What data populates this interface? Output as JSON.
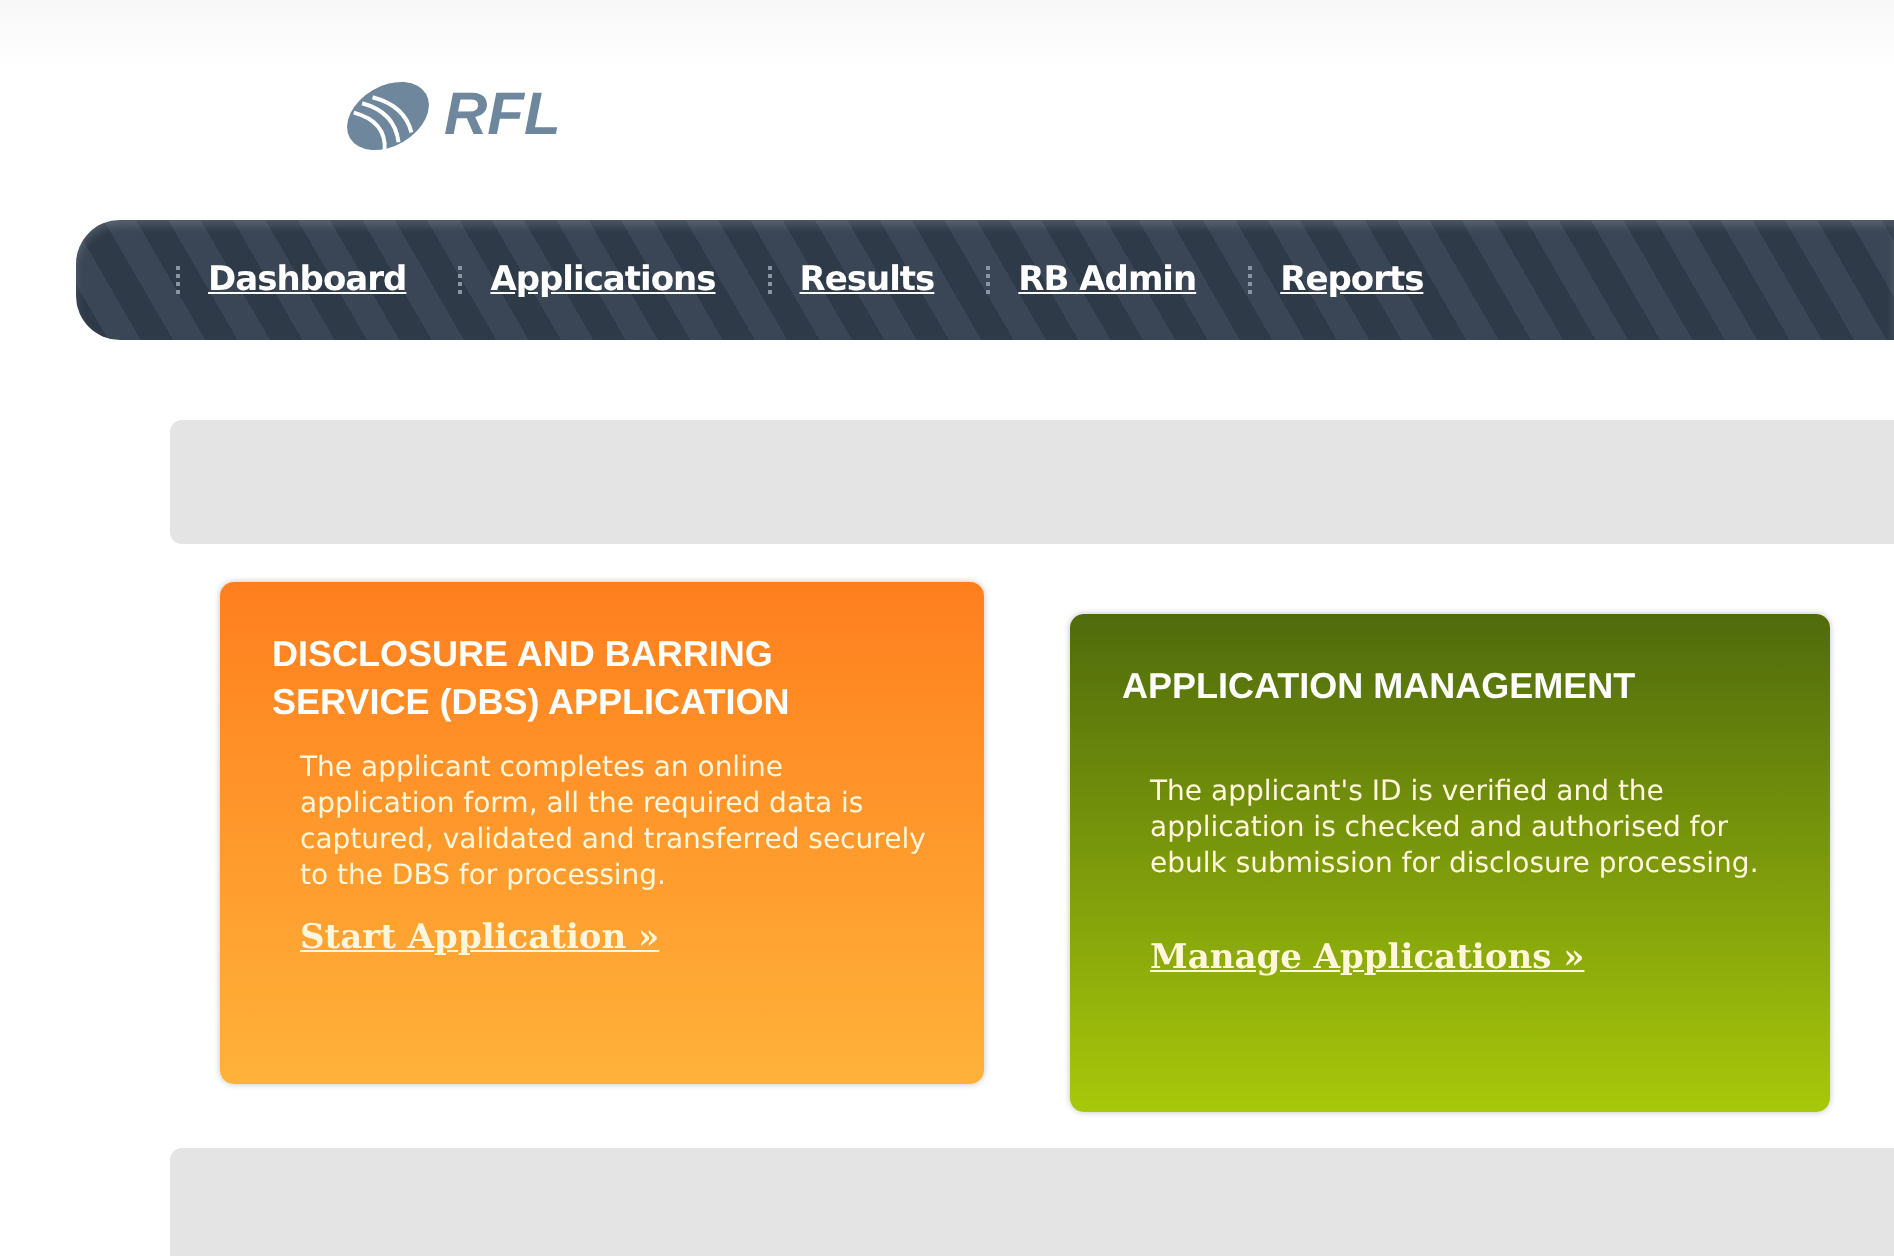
{
  "logo": {
    "text": "RFL"
  },
  "nav": {
    "items": [
      {
        "label": "Dashboard"
      },
      {
        "label": "Applications"
      },
      {
        "label": "Results"
      },
      {
        "label": "RB Admin"
      },
      {
        "label": "Reports"
      }
    ]
  },
  "cards": [
    {
      "kind": "orange",
      "title": "DISCLOSURE AND BARRING SERVICE (DBS) APPLICATION",
      "text": "The applicant completes an online application form, all the required data is captured, validated and transferred securely to the DBS for processing.",
      "link": "Start Application »"
    },
    {
      "kind": "green",
      "title": "APPLICATION MANAGEMENT",
      "text": "The applicant's ID is verified and the application is checked and authorised for ebulk submission for disclosure processing.",
      "link": "Manage Applications »"
    }
  ]
}
